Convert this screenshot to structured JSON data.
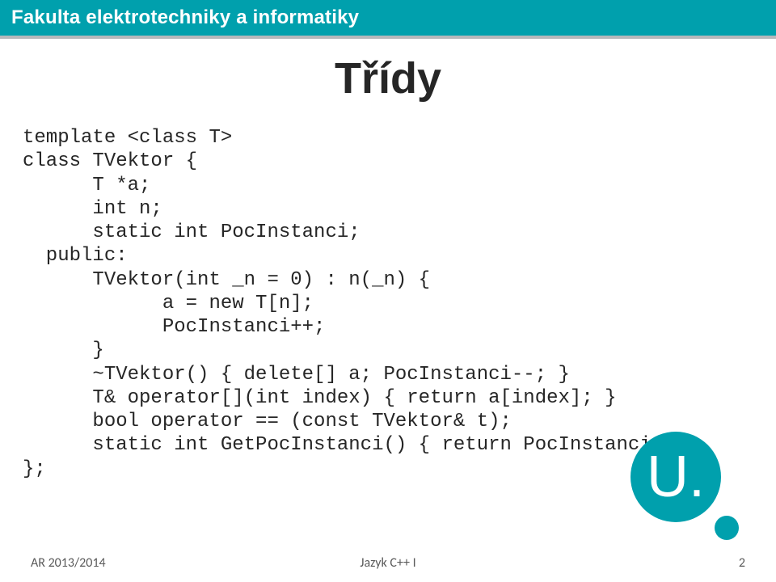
{
  "header": {
    "title": "Fakulta elektrotechniky a informatiky"
  },
  "slide": {
    "title": "Třídy",
    "code_lines": [
      "template <class T>",
      "class TVektor {",
      "      T *a;",
      "      int n;",
      "      static int PocInstanci;",
      "  public:",
      "      TVektor(int _n = 0) : n(_n) {",
      "            a = new T[n];",
      "            PocInstanci++;",
      "      }",
      "      ~TVektor() { delete[] a; PocInstanci--; }",
      "      T& operator[](int index) { return a[index]; }",
      "      bool operator == (const TVektor& t);",
      "      static int GetPocInstanci() { return PocInstanci; }",
      "};"
    ]
  },
  "footer": {
    "left": "AR 2013/2014",
    "center": "Jazyk C++ I",
    "page": "2"
  },
  "logo": {
    "letter": "U."
  }
}
